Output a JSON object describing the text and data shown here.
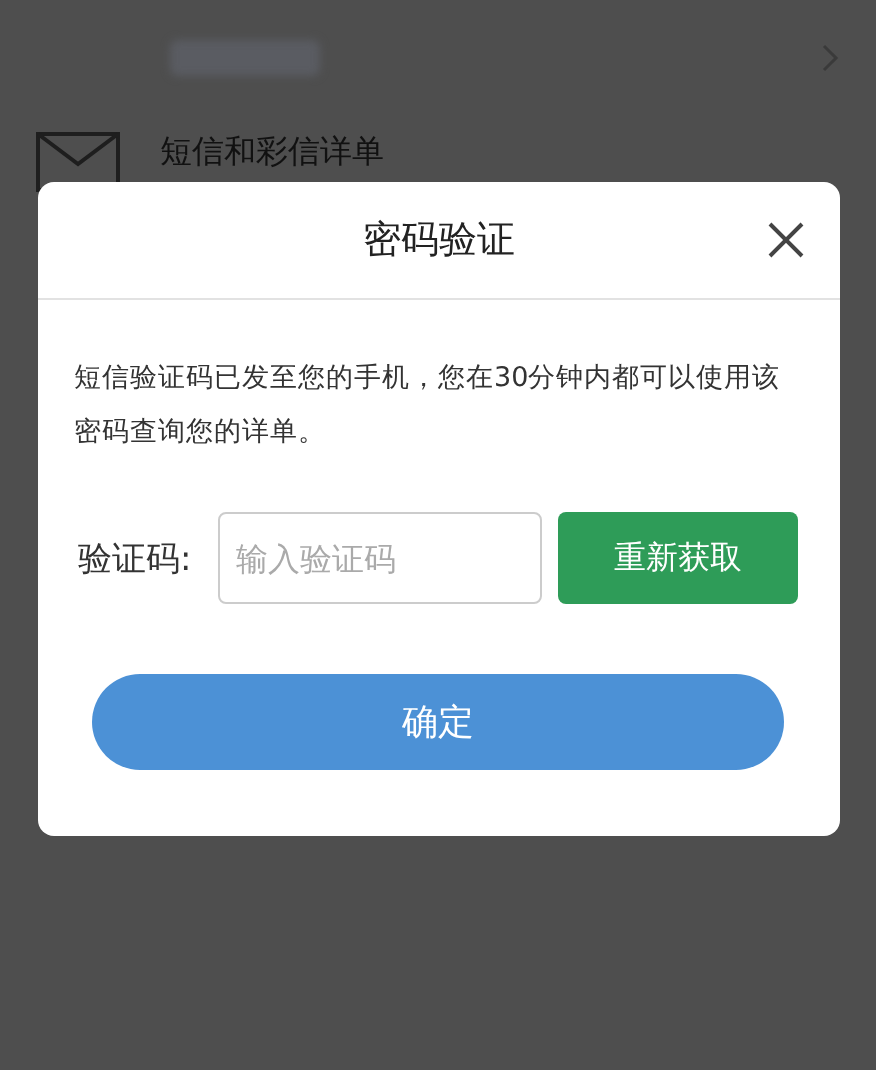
{
  "background_list": {
    "item_label": "短信和彩信详单"
  },
  "dialog": {
    "title": "密码验证",
    "message": "短信验证码已发至您的手机，您在30分钟内都可以使用该密码查询您的详单。",
    "code_label": "验证码:",
    "code_field": {
      "placeholder": "输入验证码"
    },
    "resend_button": "重新获取",
    "confirm_button": "确定"
  }
}
